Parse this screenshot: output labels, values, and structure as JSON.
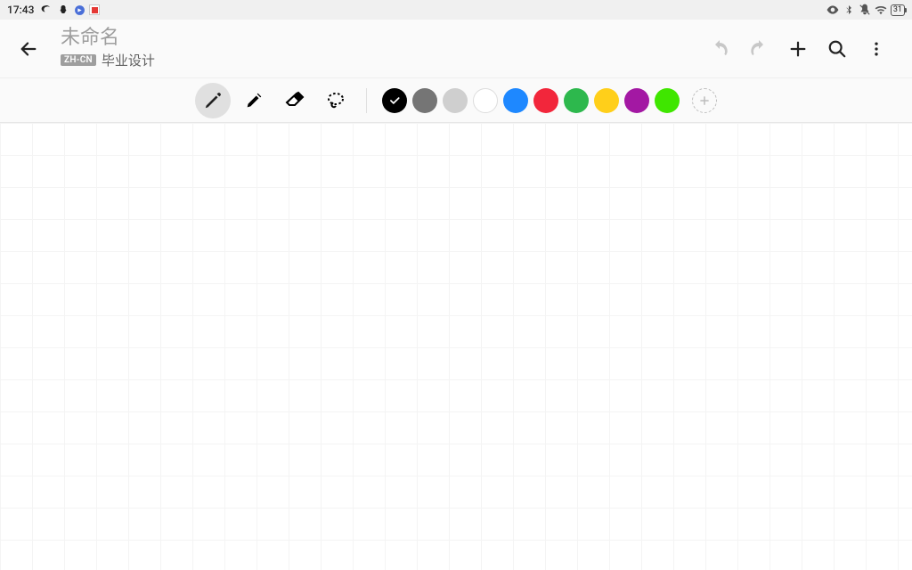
{
  "statusbar": {
    "time": "17:43",
    "battery_percent": "31"
  },
  "header": {
    "title": "未命名",
    "lang_chip": "ZH-CN",
    "subtitle": "毕业设计"
  },
  "toolbar": {
    "tools": [
      {
        "name": "pen",
        "selected": true
      },
      {
        "name": "marker",
        "selected": false
      },
      {
        "name": "eraser",
        "selected": false
      },
      {
        "name": "lasso",
        "selected": false
      }
    ],
    "colors": [
      {
        "name": "black",
        "hex": "#000000",
        "selected": true
      },
      {
        "name": "dark-gray",
        "hex": "#757575",
        "selected": false
      },
      {
        "name": "light-gray",
        "hex": "#cfcfcf",
        "selected": false
      },
      {
        "name": "white",
        "hex": "#ffffff",
        "selected": false
      },
      {
        "name": "blue",
        "hex": "#1e88ff",
        "selected": false
      },
      {
        "name": "red",
        "hex": "#f2263b",
        "selected": false
      },
      {
        "name": "green",
        "hex": "#2db84d",
        "selected": false
      },
      {
        "name": "yellow",
        "hex": "#ffcf1a",
        "selected": false
      },
      {
        "name": "purple",
        "hex": "#a318a3",
        "selected": false
      },
      {
        "name": "lime",
        "hex": "#3fe600",
        "selected": false
      }
    ]
  }
}
